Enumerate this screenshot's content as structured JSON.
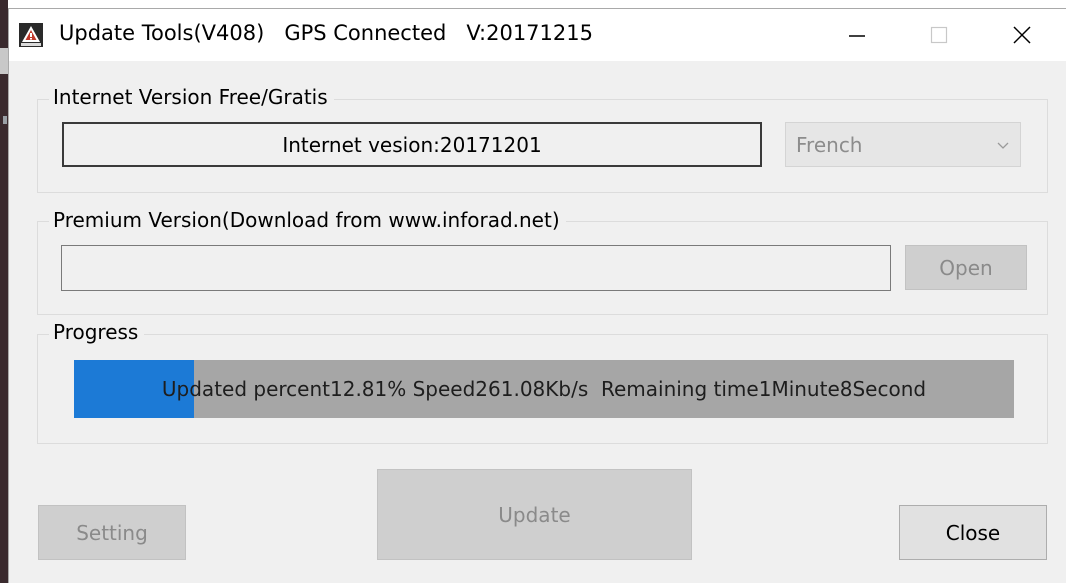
{
  "window": {
    "title": "Update Tools(V408)   GPS Connected   V:20171215"
  },
  "internet_group": {
    "title": "Internet Version Free/Gratis",
    "version_text": "Internet vesion:20171201",
    "language": "French"
  },
  "premium_group": {
    "title": "Premium Version(Download from www.inforad.net)",
    "file_path": "",
    "open_label": "Open"
  },
  "progress_group": {
    "title": "Progress",
    "percent": 12.81,
    "status_text": "Updated percent12.81% Speed261.08Kb/s  Remaining time1Minute8Second"
  },
  "buttons": {
    "setting_label": "Setting",
    "update_label": "Update",
    "close_label": "Close"
  },
  "colors": {
    "progress_fill": "#1c7ad6",
    "progress_track": "#a6a6a6"
  },
  "icons": {
    "app": "warning-triangle-icon",
    "minimize": "minimize-icon",
    "maximize": "maximize-icon",
    "close": "close-icon",
    "dropdown": "chevron-down-icon"
  }
}
